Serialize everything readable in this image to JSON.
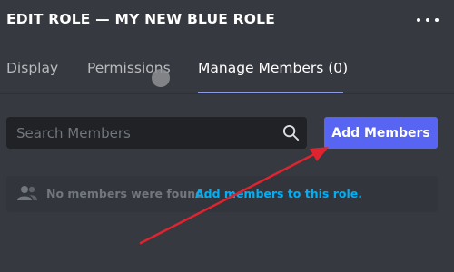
{
  "header": {
    "title": "EDIT ROLE — MY NEW BLUE ROLE",
    "more_icon": "more-horizontal-icon"
  },
  "tabs": [
    {
      "label": "Display",
      "active": false
    },
    {
      "label": "Permissions",
      "active": false
    },
    {
      "label": "Manage Members (0)",
      "active": true
    }
  ],
  "search": {
    "placeholder": "Search Members",
    "value": "",
    "icon": "search-icon"
  },
  "add_button": {
    "label": "Add Members"
  },
  "empty_state": {
    "icon": "people-icon",
    "message": "No members were found.",
    "link": "Add members to this role."
  },
  "colors": {
    "background": "#36393f",
    "accent": "#5865f2",
    "link": "#00aff4",
    "annotation_arrow": "#e0242f"
  }
}
